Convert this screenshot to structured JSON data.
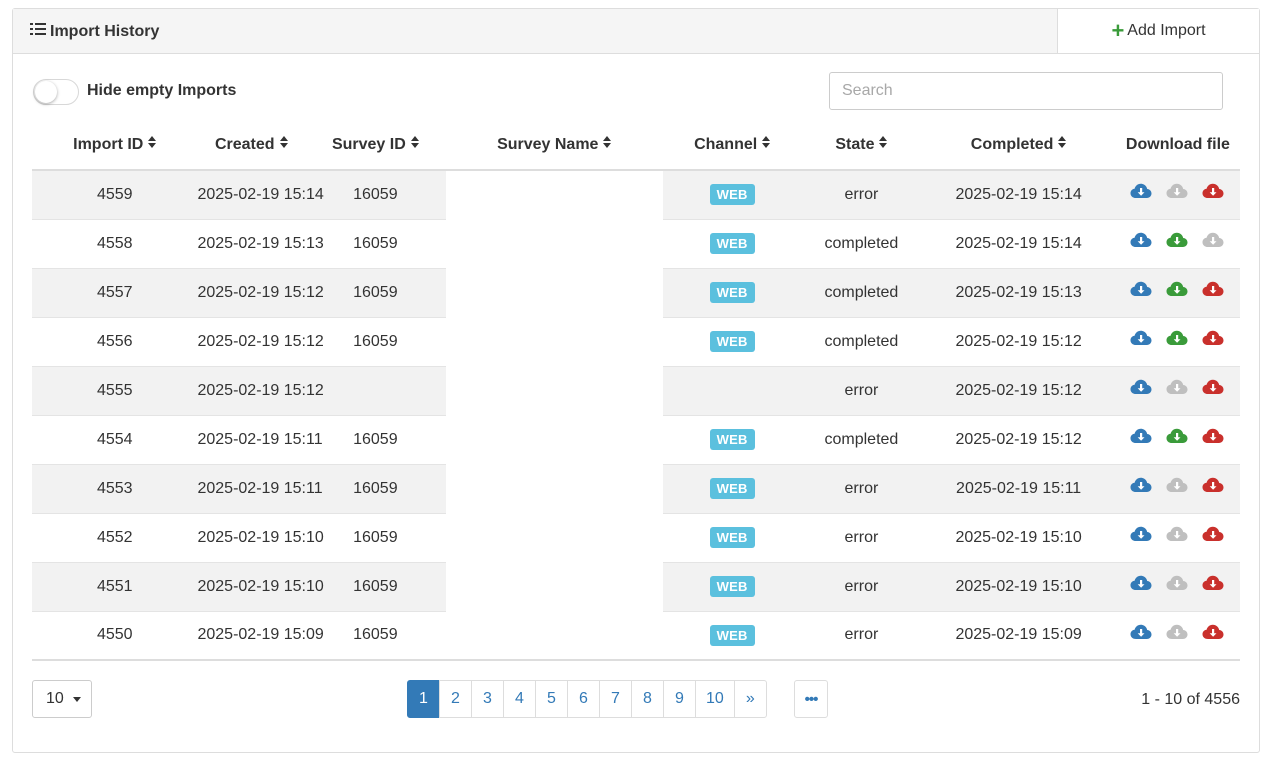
{
  "header": {
    "title": "Import History",
    "add_import_label": "Add Import"
  },
  "controls": {
    "toggle_label": "Hide empty Imports",
    "toggle_on": false,
    "search_placeholder": "Search"
  },
  "table": {
    "columns": [
      "Import ID",
      "Created",
      "Survey ID",
      "Survey Name",
      "Channel",
      "State",
      "Completed",
      "Download file"
    ],
    "rows": [
      {
        "id": "4559",
        "created": "2025-02-19 15:14",
        "survey_id": "16059",
        "survey_name": "",
        "channel": "WEB",
        "state": "error",
        "completed": "2025-02-19 15:14",
        "downloads": [
          "blue",
          "gray",
          "red"
        ]
      },
      {
        "id": "4558",
        "created": "2025-02-19 15:13",
        "survey_id": "16059",
        "survey_name": "",
        "channel": "WEB",
        "state": "completed",
        "completed": "2025-02-19 15:14",
        "downloads": [
          "blue",
          "green",
          "gray"
        ]
      },
      {
        "id": "4557",
        "created": "2025-02-19 15:12",
        "survey_id": "16059",
        "survey_name": "",
        "channel": "WEB",
        "state": "completed",
        "completed": "2025-02-19 15:13",
        "downloads": [
          "blue",
          "green",
          "red"
        ]
      },
      {
        "id": "4556",
        "created": "2025-02-19 15:12",
        "survey_id": "16059",
        "survey_name": "",
        "channel": "WEB",
        "state": "completed",
        "completed": "2025-02-19 15:12",
        "downloads": [
          "blue",
          "green",
          "red"
        ]
      },
      {
        "id": "4555",
        "created": "2025-02-19 15:12",
        "survey_id": "",
        "survey_name": "",
        "channel": "",
        "state": "error",
        "completed": "2025-02-19 15:12",
        "downloads": [
          "blue",
          "gray",
          "red"
        ]
      },
      {
        "id": "4554",
        "created": "2025-02-19 15:11",
        "survey_id": "16059",
        "survey_name": "",
        "channel": "WEB",
        "state": "completed",
        "completed": "2025-02-19 15:12",
        "downloads": [
          "blue",
          "green",
          "red"
        ]
      },
      {
        "id": "4553",
        "created": "2025-02-19 15:11",
        "survey_id": "16059",
        "survey_name": "",
        "channel": "WEB",
        "state": "error",
        "completed": "2025-02-19 15:11",
        "downloads": [
          "blue",
          "gray",
          "red"
        ]
      },
      {
        "id": "4552",
        "created": "2025-02-19 15:10",
        "survey_id": "16059",
        "survey_name": "",
        "channel": "WEB",
        "state": "error",
        "completed": "2025-02-19 15:10",
        "downloads": [
          "blue",
          "gray",
          "red"
        ]
      },
      {
        "id": "4551",
        "created": "2025-02-19 15:10",
        "survey_id": "16059",
        "survey_name": "",
        "channel": "WEB",
        "state": "error",
        "completed": "2025-02-19 15:10",
        "downloads": [
          "blue",
          "gray",
          "red"
        ]
      },
      {
        "id": "4550",
        "created": "2025-02-19 15:09",
        "survey_id": "16059",
        "survey_name": "",
        "channel": "WEB",
        "state": "error",
        "completed": "2025-02-19 15:09",
        "downloads": [
          "blue",
          "gray",
          "red"
        ]
      }
    ]
  },
  "footer": {
    "page_size": "10",
    "pages": [
      "1",
      "2",
      "3",
      "4",
      "5",
      "6",
      "7",
      "8",
      "9",
      "10",
      "»"
    ],
    "active_page": "1",
    "more_label": "•••",
    "range_text": "1 - 10 of 4556"
  },
  "colors": {
    "blue": "#337ab7",
    "green": "#3a9b3a",
    "red": "#c9302c",
    "gray": "#bfbfbf",
    "badge": "#5bc0de"
  }
}
